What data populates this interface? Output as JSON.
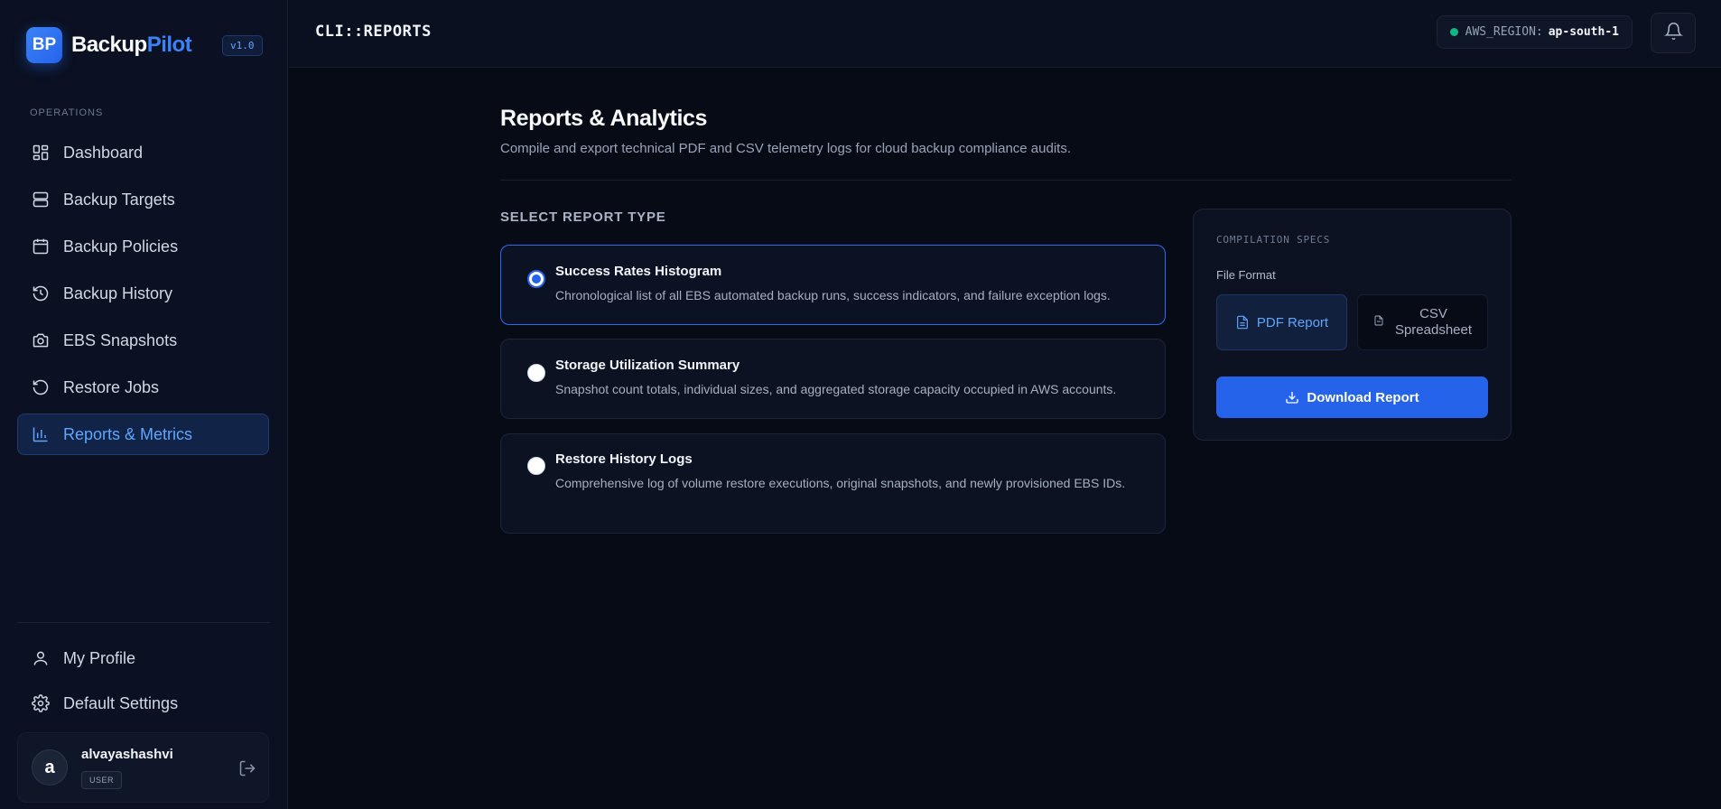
{
  "brand": {
    "logo_text": "BP",
    "name_main": "Backup",
    "name_accent": "Pilot",
    "version": "v1.0"
  },
  "sidebar": {
    "section_label": "OPERATIONS",
    "items": [
      {
        "label": "Dashboard",
        "icon": "dashboard-icon"
      },
      {
        "label": "Backup Targets",
        "icon": "server-icon"
      },
      {
        "label": "Backup Policies",
        "icon": "calendar-icon"
      },
      {
        "label": "Backup History",
        "icon": "history-icon"
      },
      {
        "label": "EBS Snapshots",
        "icon": "camera-icon"
      },
      {
        "label": "Restore Jobs",
        "icon": "rotate-ccw-icon"
      },
      {
        "label": "Reports & Metrics",
        "icon": "bar-chart-icon",
        "active": true
      }
    ],
    "bottom_items": [
      {
        "label": "My Profile",
        "icon": "user-icon"
      },
      {
        "label": "Default Settings",
        "icon": "gear-icon"
      }
    ],
    "user": {
      "initial": "a",
      "name": "alvayashashvi",
      "role": "USER"
    }
  },
  "header": {
    "page_code": "CLI::REPORTS",
    "region_key": "AWS_REGION:",
    "region_value": "ap-south-1"
  },
  "main": {
    "title": "Reports & Analytics",
    "subtitle": "Compile and export technical PDF and CSV telemetry logs for cloud backup compliance audits.",
    "section_label": "SELECT REPORT TYPE",
    "reports": [
      {
        "title": "Success Rates Histogram",
        "desc": "Chronological list of all EBS automated backup runs, success indicators, and failure exception logs.",
        "selected": true
      },
      {
        "title": "Storage Utilization Summary",
        "desc": "Snapshot count totals, individual sizes, and aggregated storage capacity occupied in AWS accounts.",
        "selected": false
      },
      {
        "title": "Restore History Logs",
        "desc": "Comprehensive log of volume restore executions, original snapshots, and newly provisioned EBS IDs.",
        "selected": false
      }
    ]
  },
  "specs": {
    "label": "COMPILATION SPECS",
    "format_label": "File Format",
    "pdf_label": "PDF Report",
    "csv_label_1": "CSV",
    "csv_label_2": "Spreadsheet",
    "download_label": "Download Report"
  },
  "colors": {
    "accent": "#2563eb",
    "accent_light": "#60a5fa",
    "status_ok": "#10b981",
    "background": "#070b16"
  }
}
